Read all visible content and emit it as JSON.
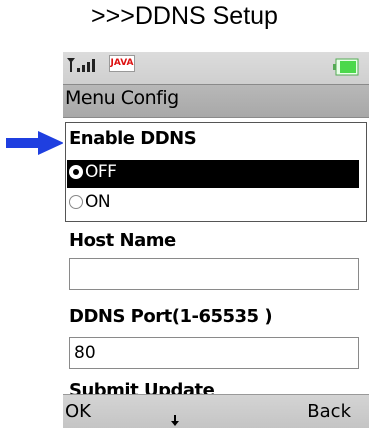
{
  "caption": ">>>DDNS Setup",
  "status_bar": {
    "java_label": "JAVA"
  },
  "title_bar": {
    "title": "Menu Config"
  },
  "form": {
    "enable_ddns": {
      "label": "Enable DDNS",
      "options": [
        {
          "label": "OFF",
          "selected": true,
          "highlighted": true
        },
        {
          "label": "ON",
          "selected": false,
          "highlighted": false
        }
      ]
    },
    "host_name": {
      "label": "Host Name",
      "value": ""
    },
    "ddns_port": {
      "label": "DDNS Port(1-65535 )",
      "value": "80"
    },
    "next_label_partial": "Submit Update"
  },
  "softkeys": {
    "left": "OK",
    "right": "Back"
  },
  "colors": {
    "arrow": "#1f3fe0",
    "highlight": "#000000",
    "bar": "#c8c8c8"
  }
}
